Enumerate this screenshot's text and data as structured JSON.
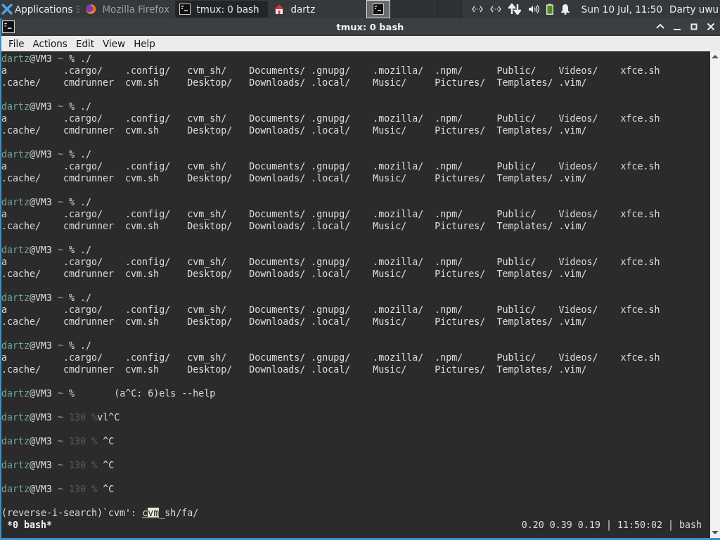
{
  "panel": {
    "app_menu": "Applications",
    "tasks": [
      {
        "title": "Mozilla Firefox",
        "kind": "browser",
        "selected": false,
        "minimized": true
      },
      {
        "title": "tmux: 0 bash",
        "kind": "terminal",
        "selected": true,
        "minimized": false
      },
      {
        "title": "dartz",
        "kind": "home",
        "selected": false,
        "minimized": false
      }
    ],
    "workspaces": [
      {
        "selected": true,
        "has_window": true
      },
      {
        "selected": false,
        "has_window": false
      },
      {
        "selected": false,
        "has_window": false
      },
      {
        "selected": false,
        "has_window": false
      }
    ],
    "clock": "Sun 10 Jul, 11:50",
    "user": "Darty uwu"
  },
  "window": {
    "title": "tmux: 0 bash"
  },
  "menu": [
    "File",
    "Actions",
    "Edit",
    "View",
    "Help"
  ],
  "terminal": {
    "lines": [
      {
        "kind": "prompt",
        "user": "dartz",
        "host": "@VM3",
        "dir": "~",
        "symbol": "%",
        "command": " ./"
      },
      {
        "kind": "listing",
        "cells": [
          "a",
          ".cargo/",
          ".config/",
          "cvm_sh/",
          "Documents/",
          ".gnupg/",
          ".mozilla/",
          ".npm/",
          "Public/",
          "Videos/",
          "xfce.sh"
        ]
      },
      {
        "kind": "listing",
        "cells": [
          ".cache/",
          "cmdrunner",
          "cvm.sh",
          "Desktop/",
          "Downloads/",
          ".local/",
          "Music/",
          "Pictures/",
          "Templates/",
          ".vim/"
        ]
      },
      {
        "kind": "blank"
      },
      {
        "kind": "prompt",
        "user": "dartz",
        "host": "@VM3",
        "dir": "~",
        "symbol": "%",
        "command": " ./"
      },
      {
        "kind": "listing",
        "cells": [
          "a",
          ".cargo/",
          ".config/",
          "cvm_sh/",
          "Documents/",
          ".gnupg/",
          ".mozilla/",
          ".npm/",
          "Public/",
          "Videos/",
          "xfce.sh"
        ]
      },
      {
        "kind": "listing",
        "cells": [
          ".cache/",
          "cmdrunner",
          "cvm.sh",
          "Desktop/",
          "Downloads/",
          ".local/",
          "Music/",
          "Pictures/",
          "Templates/",
          ".vim/"
        ]
      },
      {
        "kind": "blank"
      },
      {
        "kind": "prompt",
        "user": "dartz",
        "host": "@VM3",
        "dir": "~",
        "symbol": "%",
        "command": " ./"
      },
      {
        "kind": "listing",
        "cells": [
          "a",
          ".cargo/",
          ".config/",
          "cvm_sh/",
          "Documents/",
          ".gnupg/",
          ".mozilla/",
          ".npm/",
          "Public/",
          "Videos/",
          "xfce.sh"
        ]
      },
      {
        "kind": "listing",
        "cells": [
          ".cache/",
          "cmdrunner",
          "cvm.sh",
          "Desktop/",
          "Downloads/",
          ".local/",
          "Music/",
          "Pictures/",
          "Templates/",
          ".vim/"
        ]
      },
      {
        "kind": "blank"
      },
      {
        "kind": "prompt",
        "user": "dartz",
        "host": "@VM3",
        "dir": "~",
        "symbol": "%",
        "command": " ./"
      },
      {
        "kind": "listing",
        "cells": [
          "a",
          ".cargo/",
          ".config/",
          "cvm_sh/",
          "Documents/",
          ".gnupg/",
          ".mozilla/",
          ".npm/",
          "Public/",
          "Videos/",
          "xfce.sh"
        ]
      },
      {
        "kind": "listing",
        "cells": [
          ".cache/",
          "cmdrunner",
          "cvm.sh",
          "Desktop/",
          "Downloads/",
          ".local/",
          "Music/",
          "Pictures/",
          "Templates/",
          ".vim/"
        ]
      },
      {
        "kind": "blank"
      },
      {
        "kind": "prompt",
        "user": "dartz",
        "host": "@VM3",
        "dir": "~",
        "symbol": "%",
        "command": " ./"
      },
      {
        "kind": "listing",
        "cells": [
          "a",
          ".cargo/",
          ".config/",
          "cvm_sh/",
          "Documents/",
          ".gnupg/",
          ".mozilla/",
          ".npm/",
          "Public/",
          "Videos/",
          "xfce.sh"
        ]
      },
      {
        "kind": "listing",
        "cells": [
          ".cache/",
          "cmdrunner",
          "cvm.sh",
          "Desktop/",
          "Downloads/",
          ".local/",
          "Music/",
          "Pictures/",
          "Templates/",
          ".vim/"
        ]
      },
      {
        "kind": "blank"
      },
      {
        "kind": "prompt",
        "user": "dartz",
        "host": "@VM3",
        "dir": "~",
        "symbol": "%",
        "command": " ./"
      },
      {
        "kind": "listing",
        "cells": [
          "a",
          ".cargo/",
          ".config/",
          "cvm_sh/",
          "Documents/",
          ".gnupg/",
          ".mozilla/",
          ".npm/",
          "Public/",
          "Videos/",
          "xfce.sh"
        ]
      },
      {
        "kind": "listing",
        "cells": [
          ".cache/",
          "cmdrunner",
          "cvm.sh",
          "Desktop/",
          "Downloads/",
          ".local/",
          "Music/",
          "Pictures/",
          "Templates/",
          ".vim/"
        ]
      },
      {
        "kind": "blank"
      },
      {
        "kind": "prompt",
        "user": "dartz",
        "host": "@VM3",
        "dir": "~",
        "symbol": "%",
        "command": " ./"
      },
      {
        "kind": "listing",
        "cells": [
          "a",
          ".cargo/",
          ".config/",
          "cvm_sh/",
          "Documents/",
          ".gnupg/",
          ".mozilla/",
          ".npm/",
          "Public/",
          "Videos/",
          "xfce.sh"
        ]
      },
      {
        "kind": "listing",
        "cells": [
          ".cache/",
          "cmdrunner",
          "cvm.sh",
          "Desktop/",
          "Downloads/",
          ".local/",
          "Music/",
          "Pictures/",
          "Templates/",
          ".vim/"
        ]
      },
      {
        "kind": "blank"
      },
      {
        "kind": "prompt",
        "user": "dartz",
        "host": "@VM3",
        "dir": "~",
        "symbol": "%",
        "command": "       (a^C: 6)els --help"
      },
      {
        "kind": "blank"
      },
      {
        "kind": "prompt",
        "user": "dartz",
        "host": "@VM3",
        "dir": "~",
        "status": "130",
        "symbol": "%",
        "command": "vl^C"
      },
      {
        "kind": "blank"
      },
      {
        "kind": "prompt",
        "user": "dartz",
        "host": "@VM3",
        "dir": "~",
        "status": "130",
        "symbol": "%",
        "command": " ^C"
      },
      {
        "kind": "blank"
      },
      {
        "kind": "prompt",
        "user": "dartz",
        "host": "@VM3",
        "dir": "~",
        "status": "130",
        "symbol": "%",
        "command": " ^C"
      },
      {
        "kind": "blank"
      },
      {
        "kind": "prompt",
        "user": "dartz",
        "host": "@VM3",
        "dir": "~",
        "status": "130",
        "symbol": "%",
        "command": " ^C"
      },
      {
        "kind": "blank"
      },
      {
        "kind": "search",
        "label": "(reverse-i-search)`cvm': ",
        "match_start": "c",
        "cursor": "vm",
        "match_rest": "_sh/fa/"
      }
    ],
    "status_bar": {
      "left": "*0 bash*",
      "right": "0.20 0.39 0.19 | 11:50:02 | bash"
    }
  }
}
